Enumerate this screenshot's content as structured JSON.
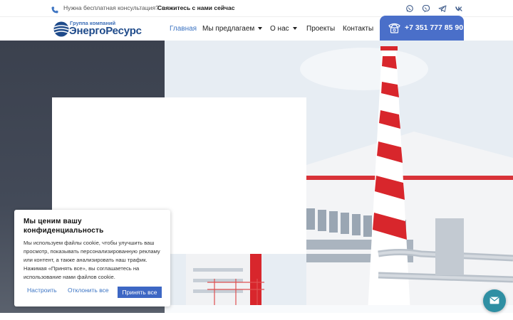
{
  "topbar": {
    "question": "Нужна бесплатная консультация?",
    "contact_link": "Свяжитесь с нами сейчас",
    "socials": [
      "whatsapp-icon",
      "viber-icon",
      "telegram-icon",
      "vk-icon"
    ]
  },
  "logo": {
    "subtitle": "Группа компаний",
    "name": "ЭнергоРесурс"
  },
  "nav": {
    "items": [
      {
        "label": "Главная",
        "active": true
      },
      {
        "label": "Мы предлагаем",
        "dropdown": true
      },
      {
        "label": "О нас",
        "dropdown": true
      },
      {
        "label": "Проекты"
      },
      {
        "label": "Контакты"
      }
    ],
    "phone": "+7 351 777 85 90"
  },
  "cookie": {
    "title": "Мы ценим вашу конфиденциальность",
    "text": "Мы используем файлы cookie, чтобы улучшить ваш просмотр, показывать персонализированную рекламу или контент, а также анализировать наш трафик. Нажимая «Принять все», вы соглашаетесь на использование нами файлов cookie.",
    "customize": "Настроить",
    "reject": "Отклонить все",
    "accept": "Принять все"
  },
  "colors": {
    "brand": "#1e4a8a",
    "accent": "#4a6fc9",
    "chimney_red": "#d8262c",
    "chat": "#2f8fa3"
  }
}
